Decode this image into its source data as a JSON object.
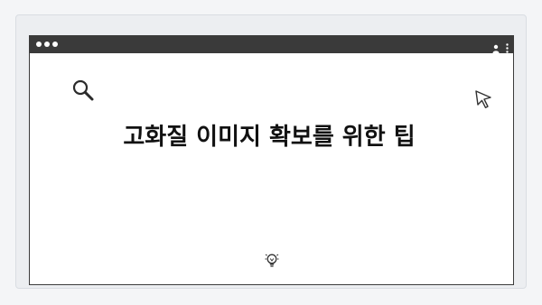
{
  "carousel": {
    "dots": 4
  },
  "browser": {
    "icons": [
      "user-icon",
      "more-vertical-icon",
      "search-icon",
      "cursor-icon",
      "lightbulb-icon"
    ]
  },
  "main": {
    "title": "고화질 이미지 확보를 위한 팁"
  }
}
